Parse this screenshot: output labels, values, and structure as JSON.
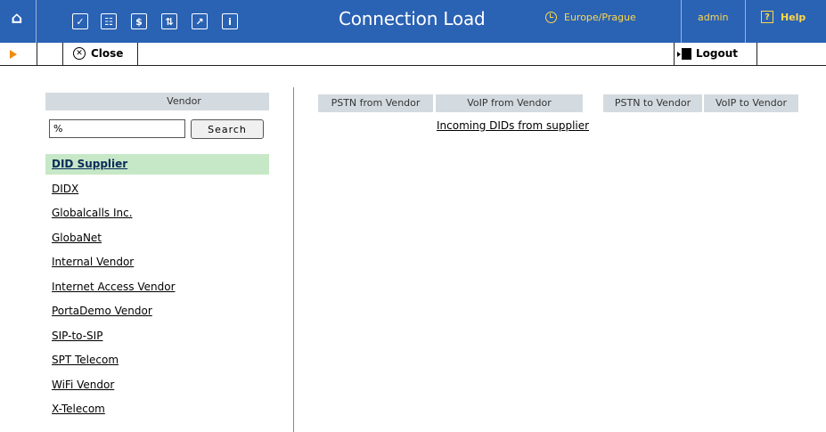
{
  "header": {
    "title": "Connection Load",
    "timezone": "Europe/Prague",
    "user": "admin",
    "help_label": "Help",
    "nav_icons": [
      "home-icon",
      "check-icon",
      "grid-icon",
      "dollar-icon",
      "transfer-icon",
      "chart-icon",
      "info-icon"
    ]
  },
  "toolbar": {
    "close_label": "Close",
    "logout_label": "Logout"
  },
  "vendor_panel": {
    "header": "Vendor",
    "search_value": "%",
    "search_button": "Search",
    "vendors": [
      {
        "label": "DID Supplier",
        "selected": true
      },
      {
        "label": "DIDX",
        "selected": false
      },
      {
        "label": "Globalcalls Inc.",
        "selected": false
      },
      {
        "label": "GlobaNet",
        "selected": false
      },
      {
        "label": "Internal Vendor",
        "selected": false
      },
      {
        "label": "Internet Access Vendor",
        "selected": false
      },
      {
        "label": "PortaDemo Vendor",
        "selected": false
      },
      {
        "label": "SIP-to-SIP",
        "selected": false
      },
      {
        "label": "SPT Telecom",
        "selected": false
      },
      {
        "label": "WiFi Vendor",
        "selected": false
      },
      {
        "label": "X-Telecom",
        "selected": false
      }
    ]
  },
  "load_table": {
    "columns": [
      "PSTN from Vendor",
      "VoIP from Vendor",
      "PSTN to Vendor",
      "VoIP to Vendor"
    ],
    "link_label": "Incoming DIDs from supplier"
  },
  "colors": {
    "header_bg": "#2a62b4",
    "accent_yellow": "#ffd84a",
    "selected_row": "#c6e8c6",
    "table_header_bg": "#d4dbe0",
    "arrow_orange": "#f08a10"
  }
}
